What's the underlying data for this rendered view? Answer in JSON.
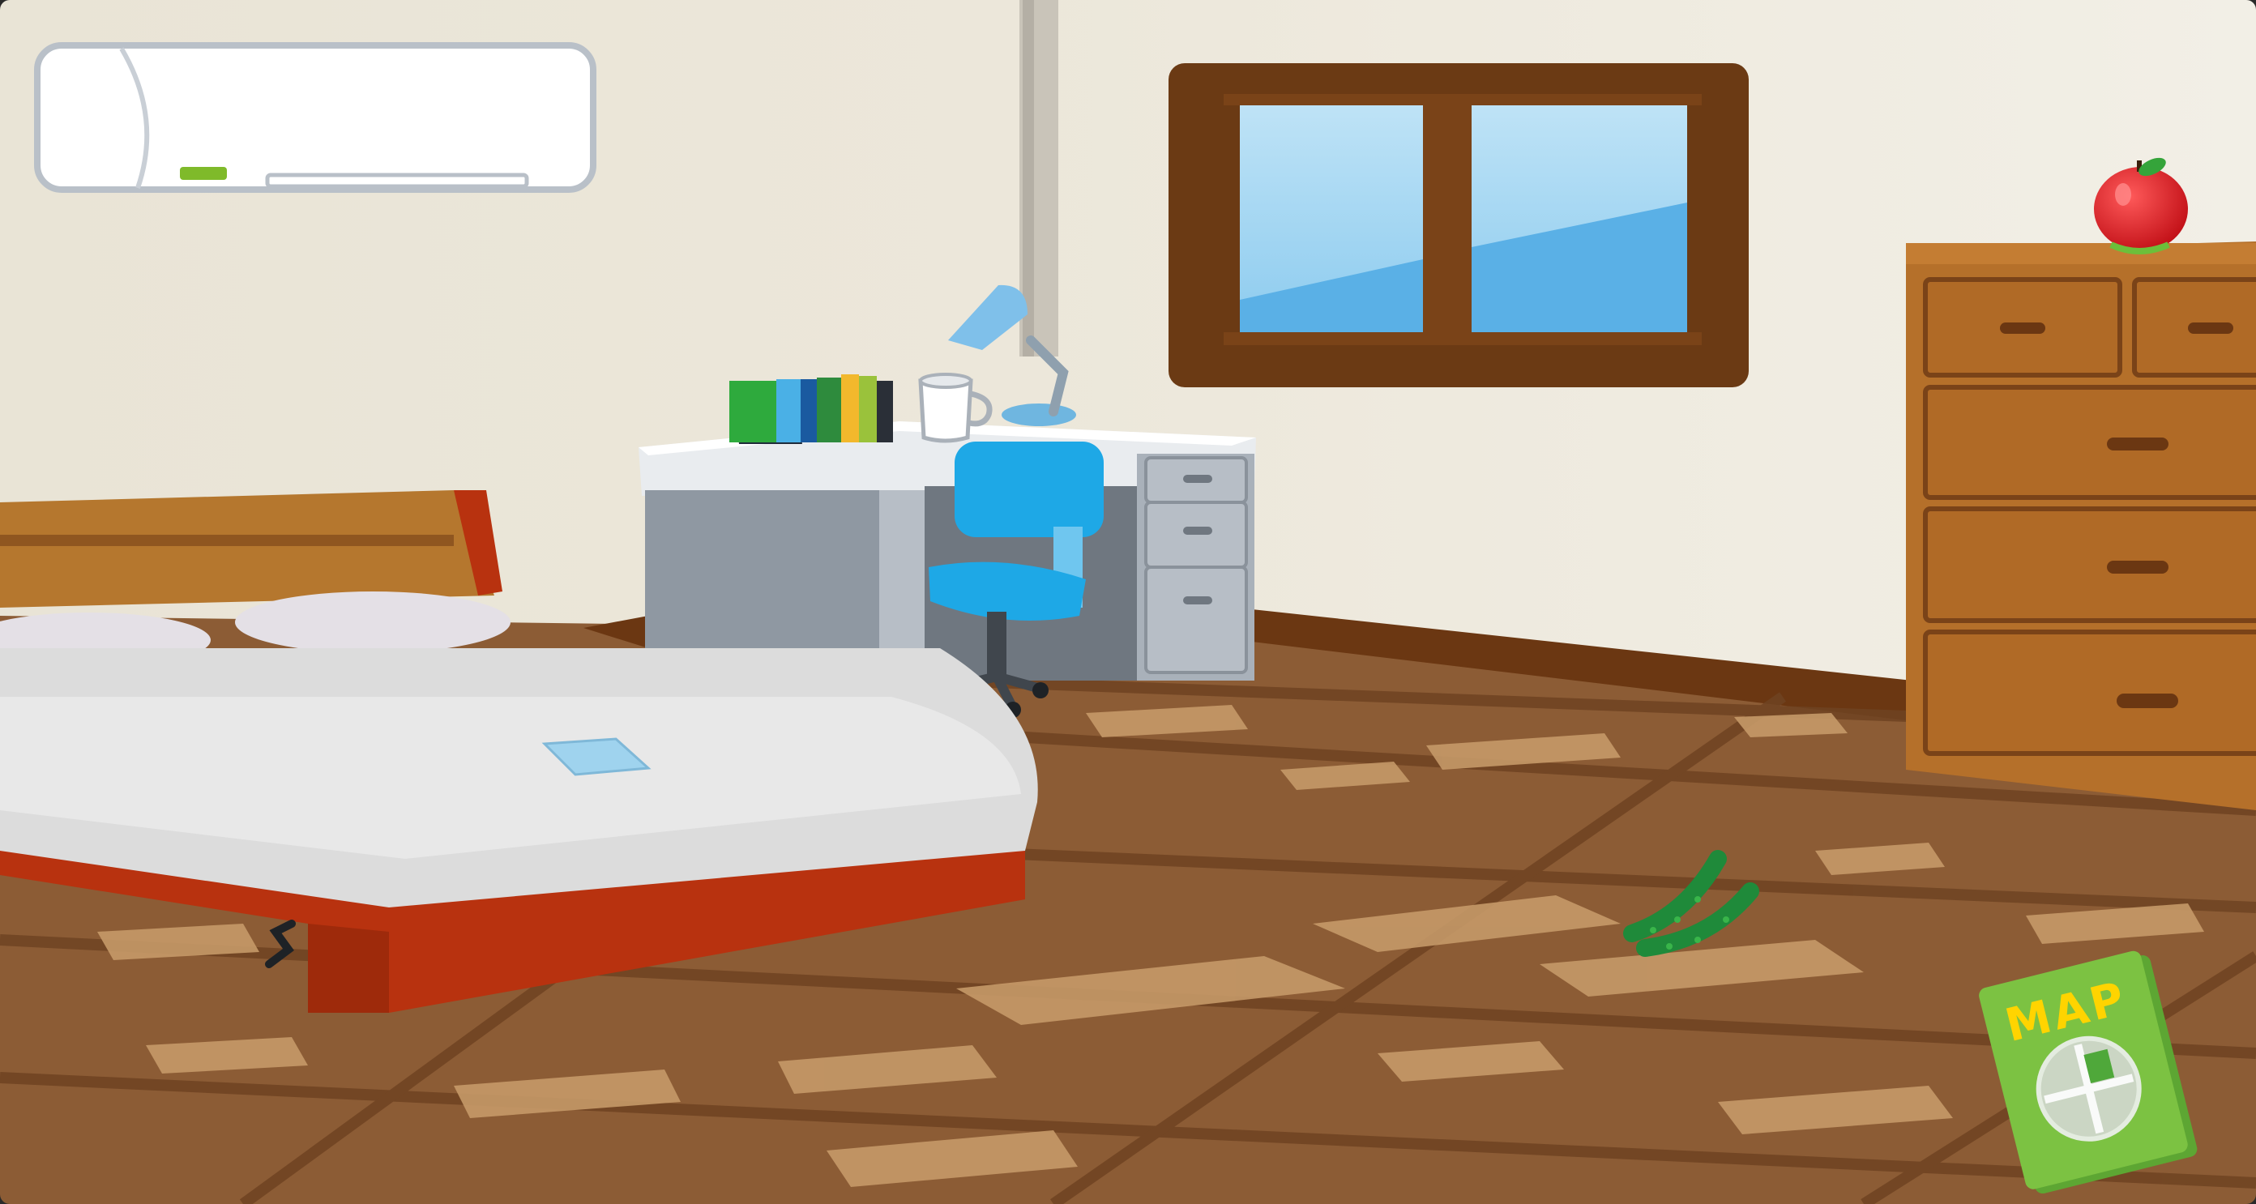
{
  "scene": {
    "name": "bedroom",
    "colors": {
      "wall": "#ebe6da",
      "floor": "#8a5a34",
      "floor_light": "#c49766",
      "bed_frame": "#b8320f",
      "bedding": "#dedede",
      "desk": "#a9b1ba",
      "chair": "#1ea8e6",
      "dresser": "#b5702a",
      "window_frame": "#6b3a14",
      "sky": "#a9d8f2",
      "map_cover": "#7cc242",
      "map_text": "#ffd400",
      "apple": "#d6141c"
    }
  },
  "map_item": {
    "label": "MAP"
  }
}
